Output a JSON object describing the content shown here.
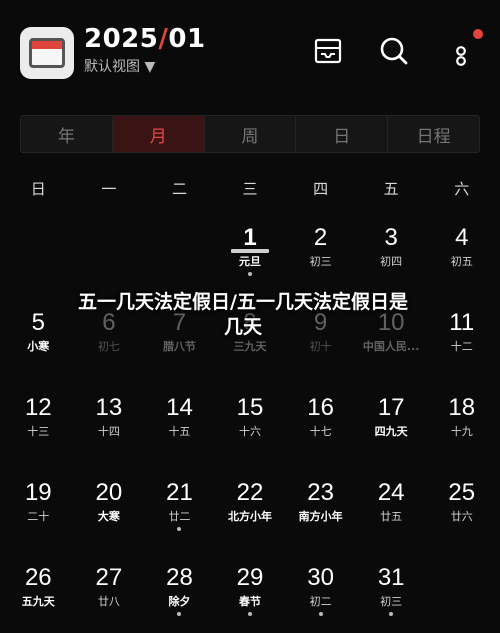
{
  "header": {
    "year": "2025",
    "slash": "/",
    "month": "01",
    "view_toggle": "默认视图 ▼"
  },
  "icons": [
    "calendar-app-icon",
    "inbox-icon",
    "search-icon",
    "more-icon"
  ],
  "colors": {
    "accent": "#e0443a",
    "background": "#0a0a0a"
  },
  "tabs": [
    {
      "label": "年",
      "active": false
    },
    {
      "label": "月",
      "active": true
    },
    {
      "label": "周",
      "active": false
    },
    {
      "label": "日",
      "active": false
    },
    {
      "label": "日程",
      "active": false
    }
  ],
  "weekdays": [
    "日",
    "一",
    "二",
    "三",
    "四",
    "五",
    "六"
  ],
  "weeks": [
    [
      {
        "day": "",
        "sub": ""
      },
      {
        "day": "",
        "sub": ""
      },
      {
        "day": "",
        "sub": ""
      },
      {
        "day": "1",
        "sub": "元旦",
        "today": true,
        "bold": true,
        "dot": true
      },
      {
        "day": "2",
        "sub": "初三"
      },
      {
        "day": "3",
        "sub": "初四"
      },
      {
        "day": "4",
        "sub": "初五"
      }
    ],
    [
      {
        "day": "5",
        "sub": "小寒",
        "bold": true
      },
      {
        "day": "6",
        "sub": "初七",
        "dim": true
      },
      {
        "day": "7",
        "sub": "腊八节",
        "bold": true,
        "dim": true
      },
      {
        "day": "8",
        "sub": "三九天",
        "bold": true,
        "dim": true
      },
      {
        "day": "9",
        "sub": "初十",
        "dim": true
      },
      {
        "day": "10",
        "sub": "中国人民...",
        "bold": true,
        "dim": true
      },
      {
        "day": "11",
        "sub": "十二"
      }
    ],
    [
      {
        "day": "12",
        "sub": "十三"
      },
      {
        "day": "13",
        "sub": "十四"
      },
      {
        "day": "14",
        "sub": "十五"
      },
      {
        "day": "15",
        "sub": "十六"
      },
      {
        "day": "16",
        "sub": "十七"
      },
      {
        "day": "17",
        "sub": "四九天",
        "bold": true
      },
      {
        "day": "18",
        "sub": "十九"
      }
    ],
    [
      {
        "day": "19",
        "sub": "二十"
      },
      {
        "day": "20",
        "sub": "大寒",
        "bold": true
      },
      {
        "day": "21",
        "sub": "廿二",
        "dot": true
      },
      {
        "day": "22",
        "sub": "北方小年",
        "bold": true
      },
      {
        "day": "23",
        "sub": "南方小年",
        "bold": true
      },
      {
        "day": "24",
        "sub": "廿五"
      },
      {
        "day": "25",
        "sub": "廿六"
      }
    ],
    [
      {
        "day": "26",
        "sub": "五九天",
        "bold": true
      },
      {
        "day": "27",
        "sub": "廿八"
      },
      {
        "day": "28",
        "sub": "除夕",
        "bold": true,
        "dot": true
      },
      {
        "day": "29",
        "sub": "春节",
        "bold": true,
        "dot": true
      },
      {
        "day": "30",
        "sub": "初二",
        "dot": true
      },
      {
        "day": "31",
        "sub": "初三",
        "dot": true
      },
      {
        "day": "",
        "sub": ""
      }
    ]
  ],
  "overlay_title": "五一几天法定假日/五一几天法定假日是几天"
}
